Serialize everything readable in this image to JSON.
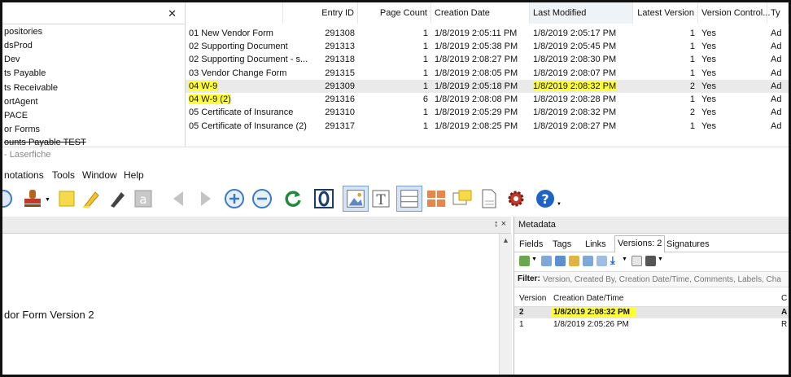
{
  "tree": {
    "items": [
      "positories",
      "dsProd",
      "Dev",
      "ts Payable",
      "ts Receivable",
      "ortAgent",
      "PACE",
      "or Forms",
      "ounts Payable TEST"
    ]
  },
  "grid": {
    "headers": {
      "entry_id": "Entry ID",
      "page_count": "Page Count",
      "creation_date": "Creation Date",
      "last_modified": "Last Modified",
      "latest_version": "Latest Version",
      "version_control": "Version Control...",
      "type": "Ty"
    },
    "rows": [
      {
        "name": "01 New Vendor Form",
        "entry_id": "291308",
        "page_count": "1",
        "creation_date": "1/8/2019 2:05:11 PM",
        "last_modified": "1/8/2019 2:05:17 PM",
        "latest_version": "1",
        "version_control": "Yes",
        "type": "Ad"
      },
      {
        "name": "02 Supporting Document",
        "entry_id": "291313",
        "page_count": "1",
        "creation_date": "1/8/2019 2:05:38 PM",
        "last_modified": "1/8/2019 2:05:45 PM",
        "latest_version": "1",
        "version_control": "Yes",
        "type": "Ad"
      },
      {
        "name": "02 Supporting Document - s...",
        "entry_id": "291318",
        "page_count": "1",
        "creation_date": "1/8/2019 2:08:27 PM",
        "last_modified": "1/8/2019 2:08:30 PM",
        "latest_version": "1",
        "version_control": "Yes",
        "type": "Ad"
      },
      {
        "name": "03 Vendor Change Form",
        "entry_id": "291315",
        "page_count": "1",
        "creation_date": "1/8/2019 2:08:05 PM",
        "last_modified": "1/8/2019 2:08:07 PM",
        "latest_version": "1",
        "version_control": "Yes",
        "type": "Ad"
      },
      {
        "name": "04 W-9",
        "entry_id": "291309",
        "page_count": "1",
        "creation_date": "1/8/2019 2:05:18 PM",
        "last_modified": "1/8/2019 2:08:32 PM",
        "latest_version": "2",
        "version_control": "Yes",
        "type": "Ad"
      },
      {
        "name": "04 W-9 (2)",
        "entry_id": "291316",
        "page_count": "6",
        "creation_date": "1/8/2019 2:08:08 PM",
        "last_modified": "1/8/2019 2:08:28 PM",
        "latest_version": "1",
        "version_control": "Yes",
        "type": "Ad"
      },
      {
        "name": "05 Certificate of Insurance",
        "entry_id": "291310",
        "page_count": "1",
        "creation_date": "1/8/2019 2:05:29 PM",
        "last_modified": "1/8/2019 2:08:32 PM",
        "latest_version": "2",
        "version_control": "Yes",
        "type": "Ad"
      },
      {
        "name": "05 Certificate of Insurance (2)",
        "entry_id": "291317",
        "page_count": "1",
        "creation_date": "1/8/2019 2:08:25 PM",
        "last_modified": "1/8/2019 2:08:27 PM",
        "latest_version": "1",
        "version_control": "Yes",
        "type": "Ad"
      }
    ]
  },
  "app": {
    "title": "- Laserfiche"
  },
  "menu": {
    "annotations": "notations",
    "tools": "Tools",
    "window": "Window",
    "help": "Help"
  },
  "document": {
    "pane_controls": "↕ ×",
    "visible_text": "dor Form Version 2"
  },
  "metadata": {
    "title": "Metadata",
    "tabs": {
      "fields": "Fields",
      "tags": "Tags",
      "links": "Links",
      "versions": "Versions: 2",
      "signatures": "Signatures"
    },
    "filter_label": "Filter:",
    "filter_placeholder": "Version, Created By, Creation Date/Time, Comments, Labels, Cha",
    "versions_headers": {
      "version": "Version",
      "creation": "Creation Date/Time",
      "extra": "C"
    },
    "versions": [
      {
        "version": "2",
        "creation": "1/8/2019 2:08:32 PM",
        "extra": "A"
      },
      {
        "version": "1",
        "creation": "1/8/2019 2:05:26 PM",
        "extra": "R"
      }
    ]
  },
  "colors": {
    "highlight": "#ffff33",
    "selection": "#eaeaea",
    "accent": "#3c78c8"
  }
}
